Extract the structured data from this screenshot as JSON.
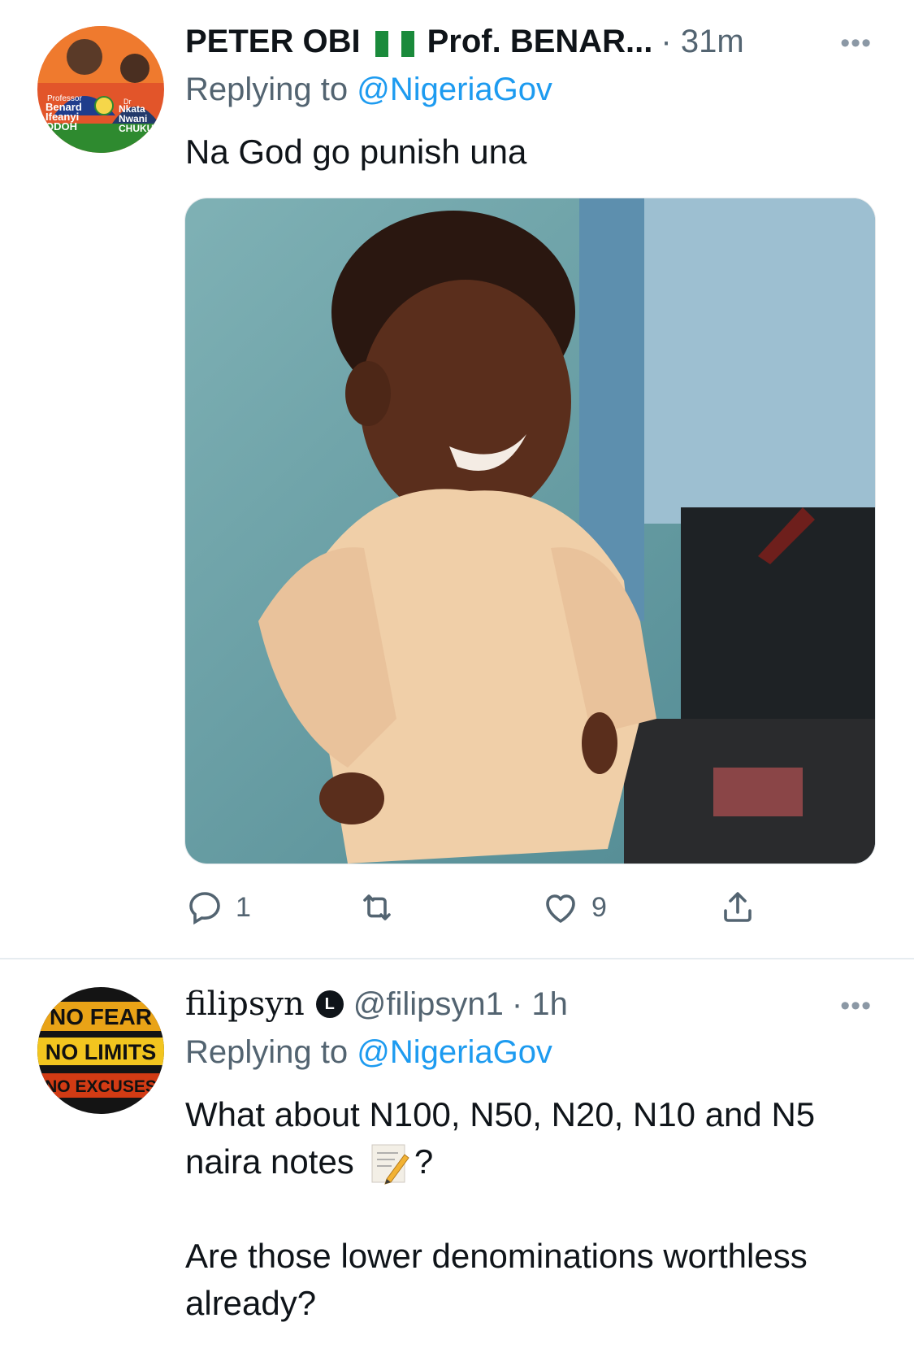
{
  "tweets": [
    {
      "display_name": "PETER OBI",
      "display_name_suffix": "Prof. BENAR...",
      "time": "· 31m",
      "more": "•••",
      "replying_prefix": "Replying to",
      "replying_to": "@NigeriaGov",
      "text": "Na God go punish una",
      "avatar_text": [
        "Professor",
        "Benard",
        "Ifeanyi",
        "ODOH",
        "Dr",
        "Nkata",
        "Nwani",
        "CHUKU"
      ],
      "actions": {
        "reply_count": "1",
        "retweet_count": "",
        "like_count": "9"
      }
    },
    {
      "display_name": "filipsyn",
      "badge": "L",
      "handle": "@filipsyn1",
      "time": "· 1h",
      "more": "•••",
      "replying_prefix": "Replying to",
      "replying_to": "@NigeriaGov",
      "text_line1": "What about N100, N50, N20, N10 and N5",
      "text_line2_pre": "naira notes",
      "text_line2_post": "?",
      "text_para2": "Are those lower denominations worthless already?",
      "avatar_text": [
        "NO FEAR",
        "NO LIMITS",
        "NO EXCUSES"
      ]
    }
  ],
  "colors": {
    "link": "#1d9bf0",
    "muted": "#536471",
    "text": "#0f1419",
    "divider": "#e6ecf0"
  }
}
